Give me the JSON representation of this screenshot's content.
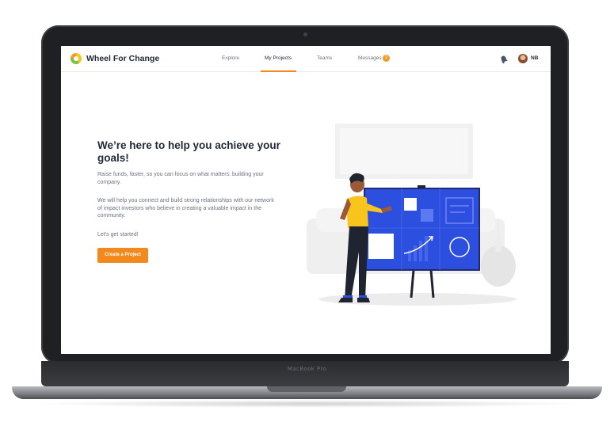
{
  "device": {
    "brand_label": "MacBook Pro"
  },
  "app": {
    "name": "Wheel For Change"
  },
  "nav": {
    "items": [
      {
        "label": "Explore"
      },
      {
        "label": "My Projects",
        "active": true
      },
      {
        "label": "Teams"
      },
      {
        "label": "Messages"
      }
    ],
    "messages_badge": "2",
    "user_initials": "NB"
  },
  "hero": {
    "title": "We’re here to help you achieve your goals!",
    "paragraph_1": "Raise funds, faster, so you can focus on what matters: building your company.",
    "paragraph_2": "We will help you connect and build strong relationships with our network of impact investors who believe in creating a valuable impact in the community.",
    "paragraph_3": "Let’s get started!",
    "cta_label": "Create a Project"
  },
  "colors": {
    "accent": "#f2891d",
    "board_blue": "#2d4fe0",
    "shirt_yellow": "#f7c51c",
    "text_dark": "#1f2937",
    "text_muted": "#6b7280"
  },
  "icons": [
    "logo-icon",
    "bell-icon",
    "avatar"
  ]
}
